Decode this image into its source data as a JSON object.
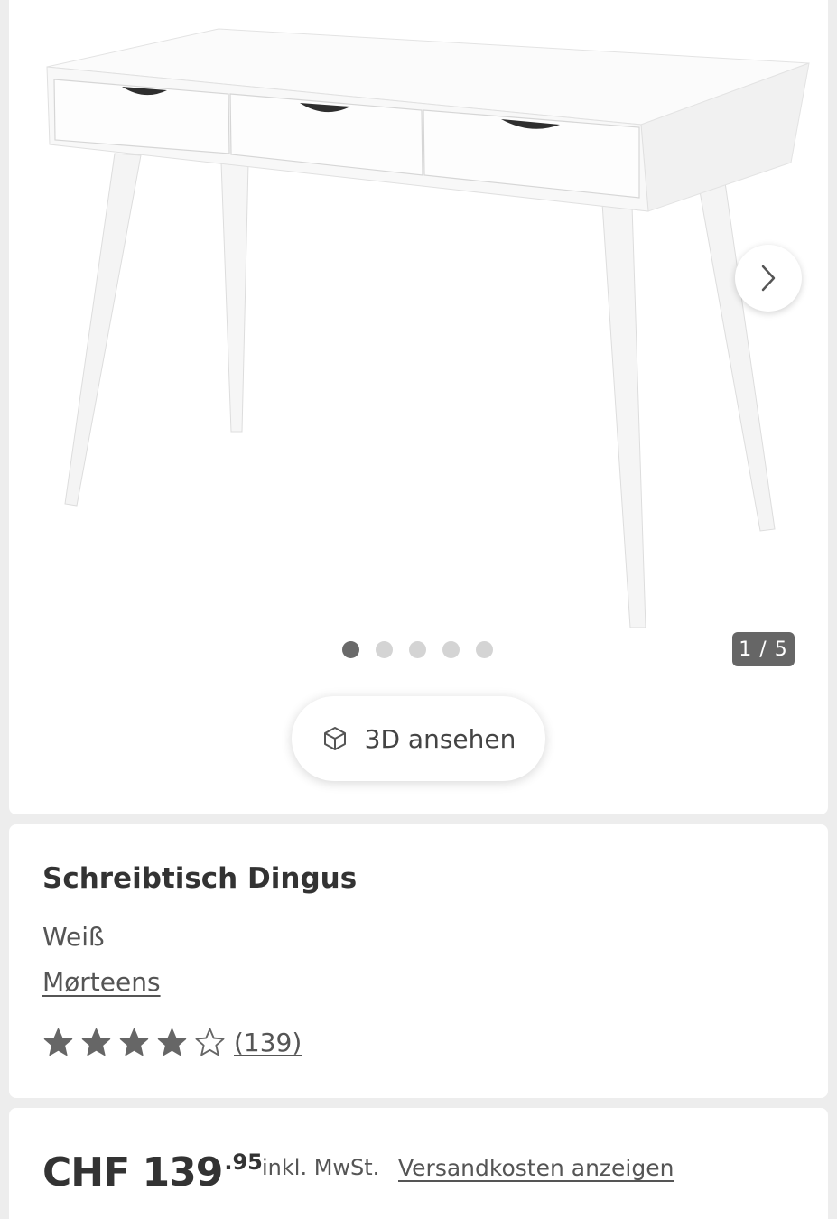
{
  "gallery": {
    "image_alt": "Schreibtisch Dingus Weiß",
    "next_icon": "chevron-right-icon",
    "current_slide": 1,
    "total_slides": 5,
    "counter_label": "1 / 5",
    "view3d": {
      "icon": "cube-icon",
      "label": "3D ansehen"
    }
  },
  "product": {
    "title": "Schreibtisch Dingus",
    "color": "Weiß",
    "brand": "Mørteens",
    "rating": {
      "value": 4,
      "max": 5,
      "count_label": "(139)"
    }
  },
  "price": {
    "currency_amount": "CHF 139",
    "cents": ".95",
    "vat_label": "inkl. MwSt.",
    "shipping_link": "Versandkosten anzeigen"
  },
  "colors": {
    "page_background": "#ededed",
    "card_background": "#ffffff",
    "text": "#333333",
    "star_fill": "#666666",
    "dot_active": "#6a6a6a",
    "dot_inactive": "#d4d4d4",
    "counter_background": "#666666"
  }
}
